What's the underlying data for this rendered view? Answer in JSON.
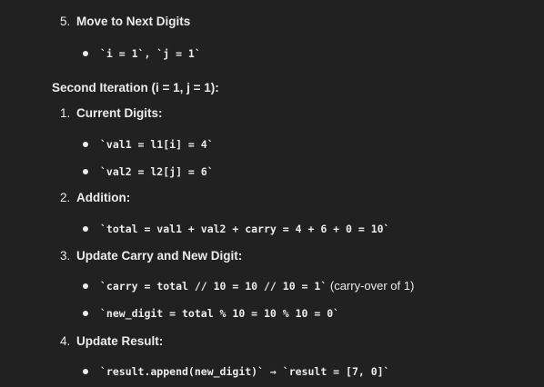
{
  "steps_top": {
    "step5": {
      "number": "5.",
      "title": "Move to Next Digits"
    },
    "step5_bullet": "`i = 1`, `j = 1`"
  },
  "iteration": {
    "heading": "Second Iteration (i = 1, j = 1):"
  },
  "steps": [
    {
      "number": "1.",
      "title": "Current Digits:"
    },
    {
      "number": "2.",
      "title": "Addition:"
    },
    {
      "number": "3.",
      "title": "Update Carry and New Digit:"
    },
    {
      "number": "4.",
      "title": "Update Result:"
    }
  ],
  "bullets": {
    "val1": "`val1 = l1[i] = 4`",
    "val2": "`val2 = l2[j] = 6`",
    "total": "`total = val1 + val2 + carry = 4 + 6 + 0 = 10`",
    "carry_code": "`carry = total // 10 = 10 // 10 = 1`",
    "carry_note": " (carry-over of 1)",
    "new_digit": "`new_digit = total % 10 = 10 % 10 = 0`",
    "result": "`result.append(new_digit)` → `result = [7, 0]`"
  },
  "colors": {
    "background": "#212121",
    "text": "#ececec"
  }
}
